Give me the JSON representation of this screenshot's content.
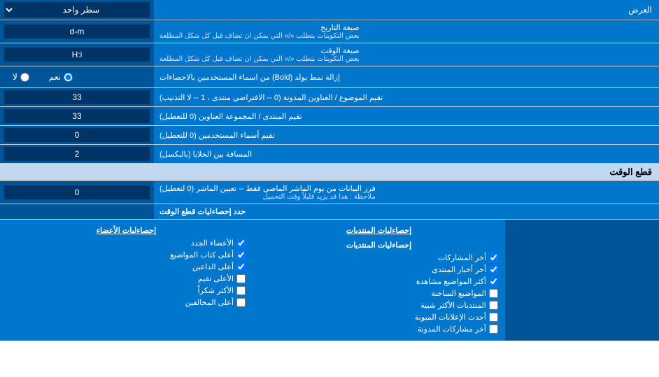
{
  "header": {
    "label": "العرض",
    "dropdown_value": "سطر واحد"
  },
  "date_format": {
    "label": "صيغة التاريخ",
    "sublabel": "بعض التكوينات يتطلب «/» التي يمكن ان تضاف قبل كل شكل المطلعة",
    "value": "d-m"
  },
  "time_format": {
    "label": "صيغة الوقت",
    "sublabel": "بعض التكوينات يتطلب «/» التي يمكن ان تضاف قبل كل شكل المطلعة",
    "value": "H:i"
  },
  "bold_remove": {
    "label": "إزالة نمط بولد (Bold) من اسماء المستخدمين بالاحصاءات",
    "option1": "نعم",
    "option2": "لا",
    "selected": "نعم"
  },
  "topics_order": {
    "label": "تقيم الموضوع / العناوين المدونة (0 -- الافتراضي منتدى ، 1 -- لا التذنيب)",
    "value": "33"
  },
  "forums_order": {
    "label": "تقيم المنتدى / المجموعة العناوين (0 للتعطيل)",
    "value": "33"
  },
  "users_order": {
    "label": "تقيم أسماء المستخدمين (0 للتعطيل)",
    "value": "0"
  },
  "cell_spacing": {
    "label": "المسافة بين الخلايا (بالبكسل)",
    "value": "2"
  },
  "section_cutoff": {
    "title": "قطع الوقت"
  },
  "cutoff": {
    "label": "فرز البيانات من يوم الماشر الماضي فقط -- تعيين الماشر (0 لتعطيل)",
    "sublabel": "ملاحظة : هذا قد يزيد قليلاً وقت التحميل",
    "value": "0"
  },
  "stats_header": {
    "label": "حدد إحصاءليات قطع الوقت"
  },
  "col1_header": "",
  "col2_header": "إحصاءليات المنتديات",
  "col3_header": "إحصاءليات الأعضاء",
  "checkboxes": {
    "col2": [
      {
        "label": "أخر المشاركات",
        "checked": true
      },
      {
        "label": "أخر أخبار المنتدى",
        "checked": true
      },
      {
        "label": "أكثر المواضيع مشاهدة",
        "checked": true
      },
      {
        "label": "المواضيع الساخنة",
        "checked": false
      },
      {
        "label": "المنتديات الأكثر شبية",
        "checked": false
      },
      {
        "label": "أحدث الإعلانات المبوبة",
        "checked": false
      },
      {
        "label": "أخر مشاركات المدونة",
        "checked": false
      }
    ],
    "col3": [
      {
        "label": "الأعضاء الجدد",
        "checked": true
      },
      {
        "label": "أعلى كتاب المواضيع",
        "checked": true
      },
      {
        "label": "أعلى الداعين",
        "checked": true
      },
      {
        "label": "الأعلى تقيم",
        "checked": false
      },
      {
        "label": "الأكثر شكراً",
        "checked": false
      },
      {
        "label": "أعلى المخالفين",
        "checked": false
      }
    ]
  }
}
